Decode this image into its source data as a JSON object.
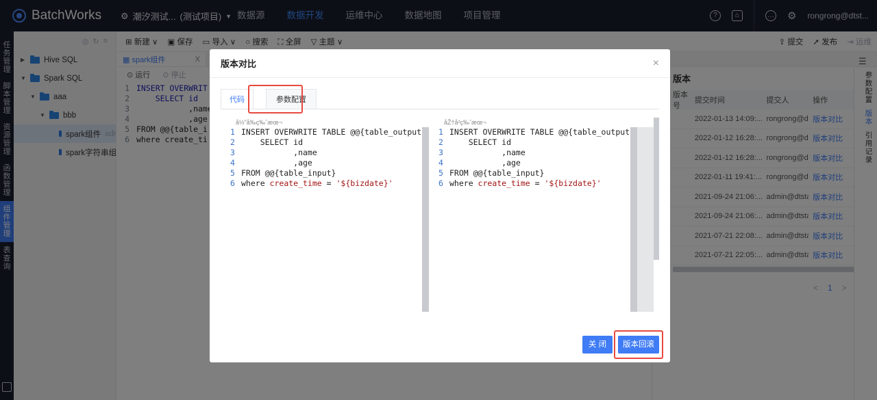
{
  "app": {
    "brand": "BatchWorks",
    "project_name": "潮汐测试...",
    "project_tag": "(测试项目)"
  },
  "nav": [
    "数据源",
    "数据开发",
    "运维中心",
    "数据地图",
    "项目管理"
  ],
  "nav_active": "数据开发",
  "user": "rongrong@dtst...",
  "left_sidebar": [
    "任务管理",
    "脚本管理",
    "资源管理",
    "函数管理",
    "组件管理",
    "表查询"
  ],
  "left_sidebar_active": "组件管理",
  "tree": {
    "items": [
      {
        "label": "Hive SQL",
        "level": 0,
        "type": "folder",
        "expanded": false
      },
      {
        "label": "Spark SQL",
        "level": 0,
        "type": "folder",
        "expanded": true
      },
      {
        "label": "aaa",
        "level": 1,
        "type": "folder",
        "expanded": true
      },
      {
        "label": "bbb",
        "level": 2,
        "type": "folder",
        "expanded": true
      },
      {
        "label": "spark组件",
        "suffix": "admi...",
        "level": 3,
        "type": "file",
        "selected": true
      },
      {
        "label": "spark字符串组...",
        "level": 3,
        "type": "file"
      }
    ]
  },
  "toolbar": {
    "new": "新建",
    "save": "保存",
    "import": "导入",
    "search": "搜索",
    "fullscreen": "全屏",
    "theme": "主题",
    "submit": "提交",
    "publish": "发布",
    "ops": "运维"
  },
  "editor_tab": {
    "label": "spark组件",
    "close": "X"
  },
  "run_bar": {
    "run": "运行",
    "stop": "停止"
  },
  "background_code": [
    {
      "n": "1",
      "text": "INSERT OVERWRIT"
    },
    {
      "n": "2",
      "text": "    SELECT id"
    },
    {
      "n": "3",
      "text": "           ,name"
    },
    {
      "n": "4",
      "text": "           ,age"
    },
    {
      "n": "5",
      "text": "FROM @@{table_i"
    },
    {
      "n": "6",
      "text": "where create_ti"
    }
  ],
  "version_panel": {
    "title": "版本",
    "headers": [
      "版本号",
      "提交时间",
      "提交人",
      "操作"
    ],
    "rows": [
      {
        "time": "2022-01-13 14:09:...",
        "user": "rongrong@dt...",
        "action": "版本对比"
      },
      {
        "time": "2022-01-12 16:28:...",
        "user": "rongrong@dt...",
        "action": "版本对比"
      },
      {
        "time": "2022-01-12 16:28:...",
        "user": "rongrong@dt...",
        "action": "版本对比"
      },
      {
        "time": "2022-01-11 19:41:...",
        "user": "rongrong@dt...",
        "action": "版本对比"
      },
      {
        "time": "2021-09-24 21:06:...",
        "user": "admin@dtsta...",
        "action": "版本对比"
      },
      {
        "time": "2021-09-24 21:06:...",
        "user": "admin@dtsta...",
        "action": "版本对比"
      },
      {
        "time": "2021-07-21 22:08:...",
        "user": "admin@dtsta...",
        "action": "版本对比"
      },
      {
        "time": "2021-07-21 22:05:...",
        "user": "admin@dtsta...",
        "action": "版本对比"
      }
    ],
    "page": "1"
  },
  "right_side_tabs": [
    "参数配置",
    "版本",
    "引用记录"
  ],
  "right_side_active": "版本",
  "modal": {
    "title": "版本对比",
    "tabs": [
      "代码",
      "参数配置"
    ],
    "active_tab": "代码",
    "left_label": "å½\"å‰ç‰ˆæœ¬",
    "right_label": "åŽ†å²ç‰ˆæœ¬",
    "code": [
      {
        "n": "1",
        "text": "INSERT OVERWRITE TABLE @@{table_output} PARTI"
      },
      {
        "n": "2",
        "text": "    SELECT id"
      },
      {
        "n": "3",
        "text": "           ,name"
      },
      {
        "n": "4",
        "text": "           ,age"
      },
      {
        "n": "5",
        "text": "FROM @@{table_input}"
      },
      {
        "n": "6",
        "pre": "where ",
        "fn": "create_time",
        "mid": " = ",
        "str": "'${bizdate}'"
      }
    ],
    "close_label": "关 闭",
    "rollback_label": "版本回滚"
  }
}
